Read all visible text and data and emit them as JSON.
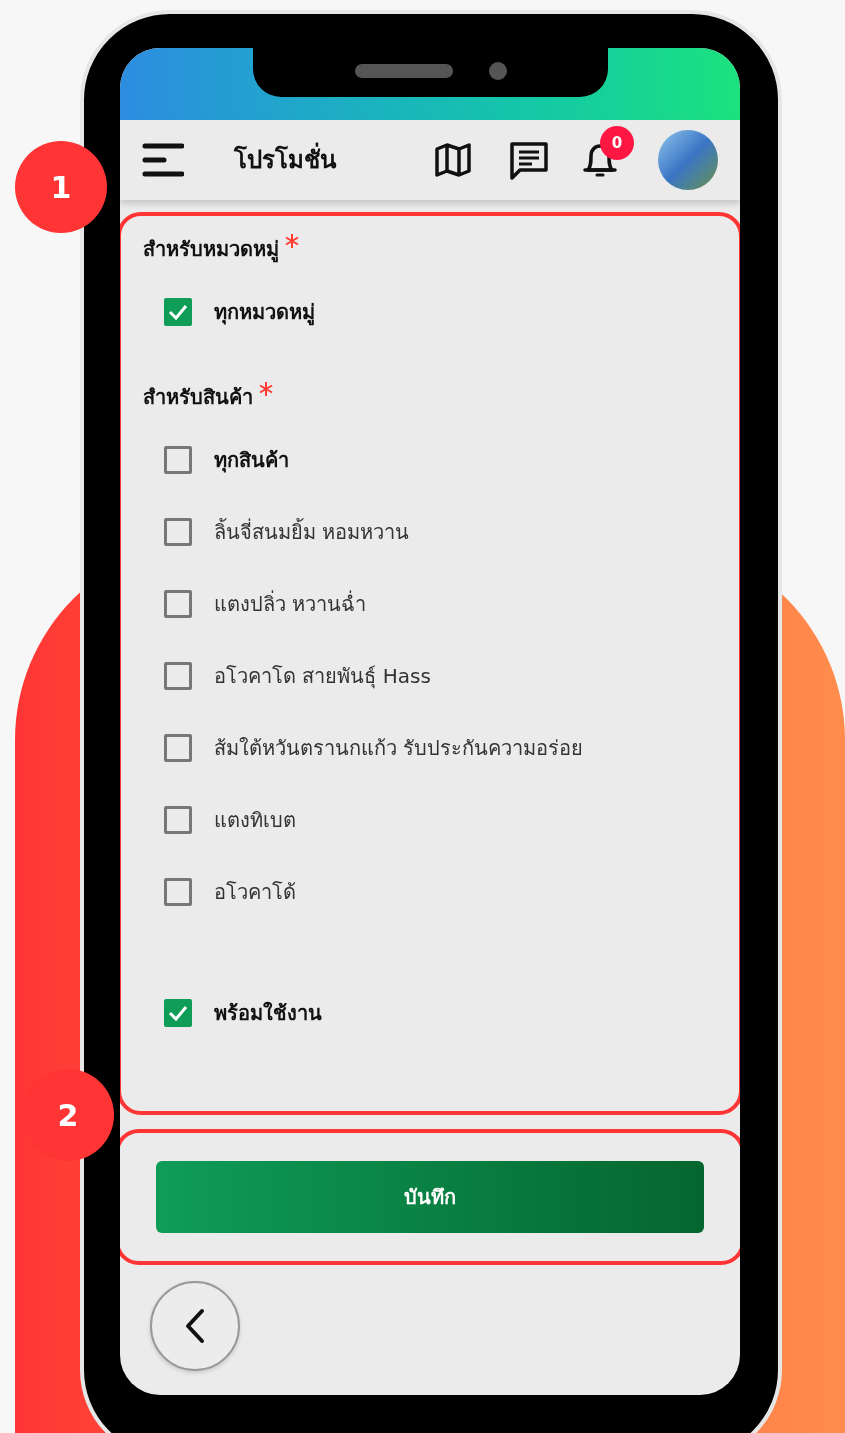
{
  "header": {
    "title": "โปรโมชั่น",
    "notification_count": "0"
  },
  "callouts": [
    "1",
    "2"
  ],
  "sections": [
    {
      "label": "สำหรับหมวดหมู่",
      "required": true,
      "options": [
        {
          "label": "ทุกหมวดหมู่",
          "kind": "all",
          "checked": true
        }
      ]
    },
    {
      "label": "สำหรับสินค้า",
      "required": true,
      "options": [
        {
          "label": "ทุกสินค้า",
          "kind": "all",
          "checked": false
        },
        {
          "label": "ลิ้นจี่สนมยิ้ม หอมหวาน",
          "kind": "item",
          "checked": false
        },
        {
          "label": "แตงปลิ่ว หวานฉ่ำ",
          "kind": "item",
          "checked": false
        },
        {
          "label": "อโวคาโด สายพันธุ์ Hass",
          "kind": "item",
          "checked": false
        },
        {
          "label": "ส้มใต้หวันตรานกแก้ว รับประกันความอร่อย",
          "kind": "item",
          "checked": false
        },
        {
          "label": "แตงทิเบต",
          "kind": "item",
          "checked": false
        },
        {
          "label": "อโวคาโด้",
          "kind": "item",
          "checked": false
        }
      ]
    }
  ],
  "ready": {
    "label": "พร้อมใช้งาน",
    "checked": true
  },
  "save_button": "บันทึก"
}
